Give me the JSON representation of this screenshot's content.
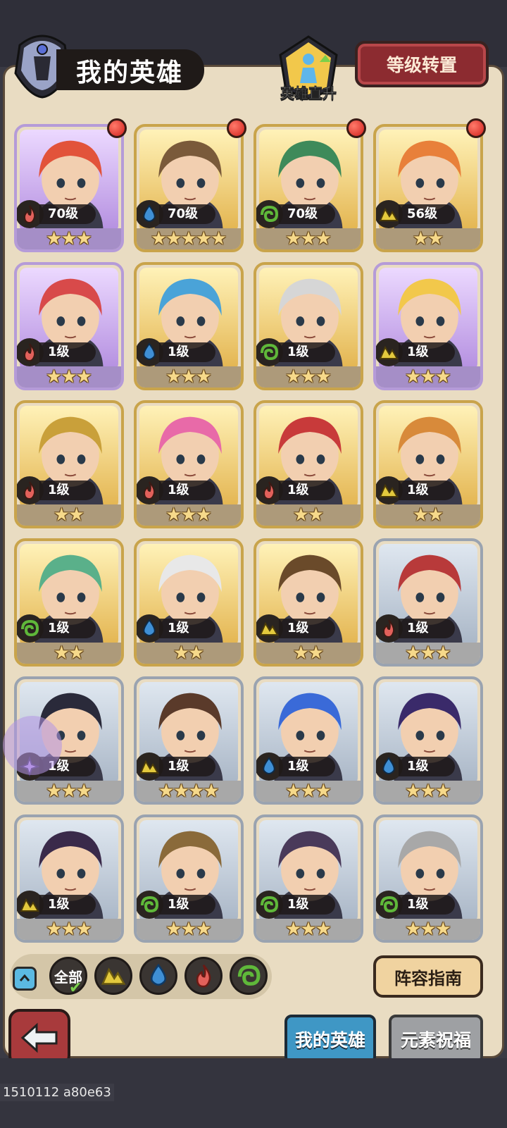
{
  "header": {
    "title": "我的英雄",
    "level_up_label": "英雄直升",
    "reset_button": "等级转置"
  },
  "heroes": [
    {
      "level": "70级",
      "stars": 3,
      "element": "fire",
      "rarity": "purple",
      "red_dot": true,
      "portrait": "coral-masked-hero"
    },
    {
      "level": "70级",
      "stars": 5,
      "element": "water",
      "rarity": "gold",
      "red_dot": true,
      "portrait": "wooden-hooded-hero"
    },
    {
      "level": "70级",
      "stars": 3,
      "element": "wind",
      "rarity": "gold",
      "red_dot": true,
      "portrait": "green-haired-hero"
    },
    {
      "level": "56级",
      "stars": 2,
      "element": "earth",
      "rarity": "gold",
      "red_dot": true,
      "portrait": "orange-haired-hero"
    },
    {
      "level": "1级",
      "stars": 3,
      "element": "fire",
      "rarity": "purple",
      "red_dot": false,
      "portrait": "red-haired-rose-hero"
    },
    {
      "level": "1级",
      "stars": 3,
      "element": "water",
      "rarity": "gold",
      "red_dot": false,
      "portrait": "blue-haired-hero"
    },
    {
      "level": "1级",
      "stars": 3,
      "element": "wind",
      "rarity": "gold",
      "red_dot": false,
      "portrait": "white-haired-elf-hero"
    },
    {
      "level": "1级",
      "stars": 3,
      "element": "earth",
      "rarity": "purple",
      "red_dot": false,
      "portrait": "blonde-hero"
    },
    {
      "level": "1级",
      "stars": 2,
      "element": "fire",
      "rarity": "gold",
      "red_dot": false,
      "portrait": "golden-helmet-hero"
    },
    {
      "level": "1级",
      "stars": 3,
      "element": "fire",
      "rarity": "gold",
      "red_dot": false,
      "portrait": "pink-haired-goggle-hero"
    },
    {
      "level": "1级",
      "stars": 2,
      "element": "fire",
      "rarity": "gold",
      "red_dot": false,
      "portrait": "red-haired-monocle-hero"
    },
    {
      "level": "1级",
      "stars": 2,
      "element": "earth",
      "rarity": "gold",
      "red_dot": false,
      "portrait": "bearded-lion-hero"
    },
    {
      "level": "1级",
      "stars": 2,
      "element": "wind",
      "rarity": "gold",
      "red_dot": false,
      "portrait": "green-haired-elf-hero"
    },
    {
      "level": "1级",
      "stars": 2,
      "element": "water",
      "rarity": "gold",
      "red_dot": false,
      "portrait": "white-haired-goggle-hero"
    },
    {
      "level": "1级",
      "stars": 2,
      "element": "earth",
      "rarity": "gold",
      "red_dot": false,
      "portrait": "dreadlock-hero"
    },
    {
      "level": "1级",
      "stars": 3,
      "element": "fire",
      "rarity": "silver",
      "red_dot": false,
      "portrait": "red-haired-elf-hero"
    },
    {
      "level": "1级",
      "stars": 3,
      "element": "arcane",
      "rarity": "silver",
      "red_dot": false,
      "portrait": "dark-haired-hero"
    },
    {
      "level": "1级",
      "stars": 4,
      "element": "earth",
      "rarity": "silver",
      "red_dot": false,
      "portrait": "bearded-man-hero"
    },
    {
      "level": "1级",
      "stars": 3,
      "element": "water",
      "rarity": "silver",
      "red_dot": false,
      "portrait": "blue-bob-hero"
    },
    {
      "level": "1级",
      "stars": 3,
      "element": "water",
      "rarity": "silver",
      "red_dot": false,
      "portrait": "purple-haired-hero"
    },
    {
      "level": "1级",
      "stars": 3,
      "element": "earth",
      "rarity": "silver",
      "red_dot": false,
      "portrait": "purple-ponytail-hero"
    },
    {
      "level": "1级",
      "stars": 3,
      "element": "wind",
      "rarity": "silver",
      "red_dot": false,
      "portrait": "treant-hero"
    },
    {
      "level": "1级",
      "stars": 3,
      "element": "wind",
      "rarity": "silver",
      "red_dot": false,
      "portrait": "horned-hooded-hero"
    },
    {
      "level": "1级",
      "stars": 3,
      "element": "wind",
      "rarity": "silver",
      "red_dot": false,
      "portrait": "knight-helmet-hero"
    }
  ],
  "filter": {
    "all_label": "全部",
    "elements": [
      "earth",
      "water",
      "fire",
      "wind"
    ]
  },
  "guide_button": "阵容指南",
  "tabs": {
    "my_heroes": "我的英雄",
    "elemental_blessing": "元素祝福"
  },
  "build_info": "1510112 a80e63",
  "colors": {
    "fire": "#e2615b",
    "water": "#3f8fd4",
    "wind": "#5fb83a",
    "earth": "#e3c93d",
    "arcane": "#b792e6"
  }
}
